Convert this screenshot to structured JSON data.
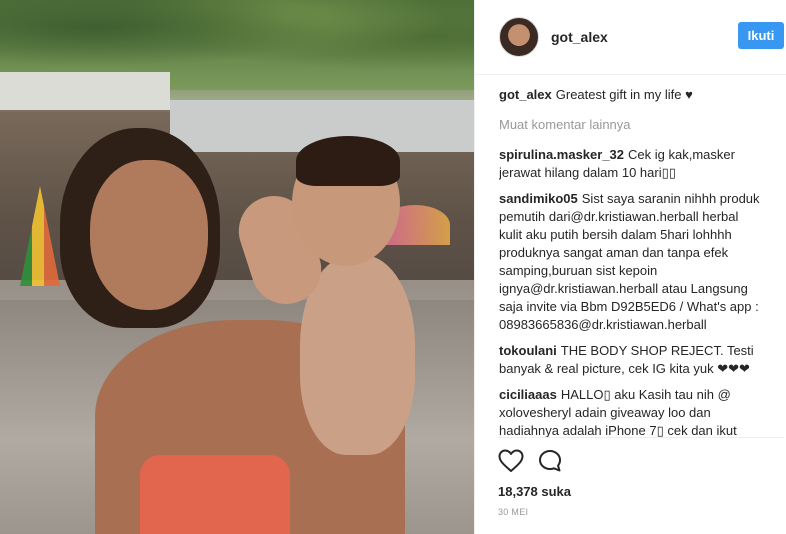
{
  "post": {
    "username": "got_alex",
    "follow_label": "Ikuti",
    "caption_author": "got_alex",
    "caption_text": "Greatest gift in my life ♥",
    "load_more_label": "Muat komentar lainnya",
    "likes": "18,378 suka",
    "date": "30 MEI"
  },
  "comments": [
    {
      "author": "spirulina.masker_32",
      "text": "Cek ig kak,masker jerawat hilang dalam 10 hari▯▯"
    },
    {
      "author": "sandimiko05",
      "text": "Sist saya saranin nihhh produk pemutih dari@dr.kristiawan.herball herbal kulit aku putih bersih dalam 5hari lohhhh produknya sangat aman dan tanpa efek samping,buruan sist kepoin ignya@dr.kristiawan.herball atau Langsung saja invite via Bbm D92B5ED6 / What's app : 08983665836@dr.kristiawan.herball"
    },
    {
      "author": "tokoulani",
      "text": "THE BODY SHOP REJECT. Testi banyak & real picture, cek IG kita yuk ❤❤❤"
    },
    {
      "author": "ciciliaaas",
      "text": "HALLO▯ aku Kasih tau nih @ xolovesheryl adain giveaway loo dan hadiahnya adalah iPhone 7▯ cek dan ikut yaa:)"
    }
  ],
  "icons": {
    "like": "heart-icon",
    "comment": "comment-bubble-icon"
  },
  "colors": {
    "follow_button": "#3897f0",
    "muted_text": "#999999",
    "primary_text": "#262626"
  }
}
